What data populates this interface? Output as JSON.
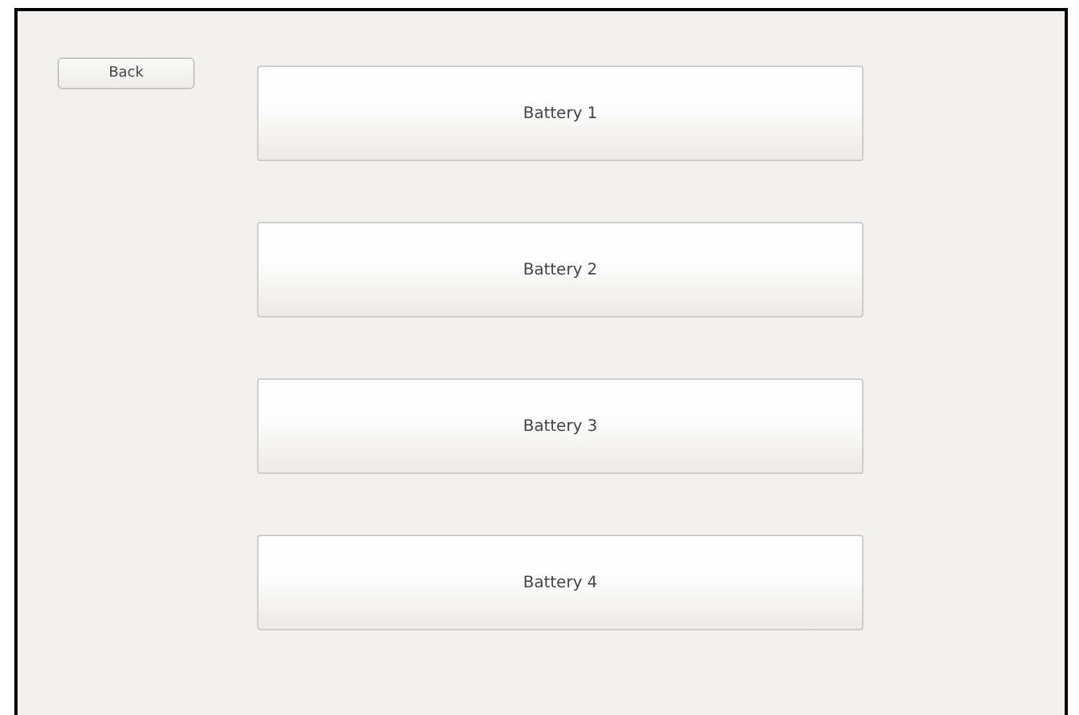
{
  "back_button": {
    "label": "Back"
  },
  "batteries": [
    {
      "label": "Battery 1"
    },
    {
      "label": "Battery 2"
    },
    {
      "label": "Battery 3"
    },
    {
      "label": "Battery 4"
    }
  ]
}
